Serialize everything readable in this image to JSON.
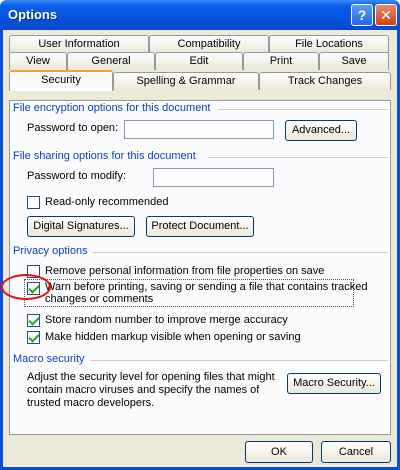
{
  "window": {
    "title": "Options",
    "help_glyph": "?",
    "close_glyph": "✕"
  },
  "tabs_row1": [
    "User Information",
    "Compatibility",
    "File Locations"
  ],
  "tabs_row2": [
    "View",
    "General",
    "Edit",
    "Print",
    "Save"
  ],
  "tabs_row3": [
    "Security",
    "Spelling & Grammar",
    "Track Changes"
  ],
  "active_tab": "Security",
  "file_encryption": {
    "heading": "File encryption options for this document",
    "password_open_label": "Password to open:",
    "password_open_value": "",
    "advanced_button": "Advanced..."
  },
  "file_sharing": {
    "heading": "File sharing options for this document",
    "password_modify_label": "Password to modify:",
    "password_modify_value": "",
    "read_only_label": "Read-only recommended",
    "read_only_checked": false,
    "digital_signatures_button": "Digital Signatures...",
    "protect_document_button": "Protect Document..."
  },
  "privacy": {
    "heading": "Privacy options",
    "items": [
      {
        "label": "Remove personal information from file properties on save",
        "checked": false
      },
      {
        "label": "Warn before printing, saving or sending a file that contains tracked",
        "label2": "changes or comments",
        "checked": true
      },
      {
        "label": "Store random number to improve merge accuracy",
        "checked": true
      },
      {
        "label": "Make hidden markup visible when opening or saving",
        "checked": true
      }
    ]
  },
  "macro": {
    "heading": "Macro security",
    "description": [
      "Adjust the security level for opening files that might",
      "contain macro viruses and specify the names of",
      "trusted macro developers."
    ],
    "macro_security_button": "Macro Security..."
  },
  "footer": {
    "ok_button": "OK",
    "cancel_button": "Cancel"
  },
  "colors": {
    "title_bar": "#0553df",
    "section_heading": "#0a3fb5",
    "dialog_bg": "#ece9d8",
    "annotation_ring": "#e01414"
  },
  "icons": {
    "help": "help-icon",
    "close": "close-icon",
    "checkmark": "checkmark-icon"
  }
}
